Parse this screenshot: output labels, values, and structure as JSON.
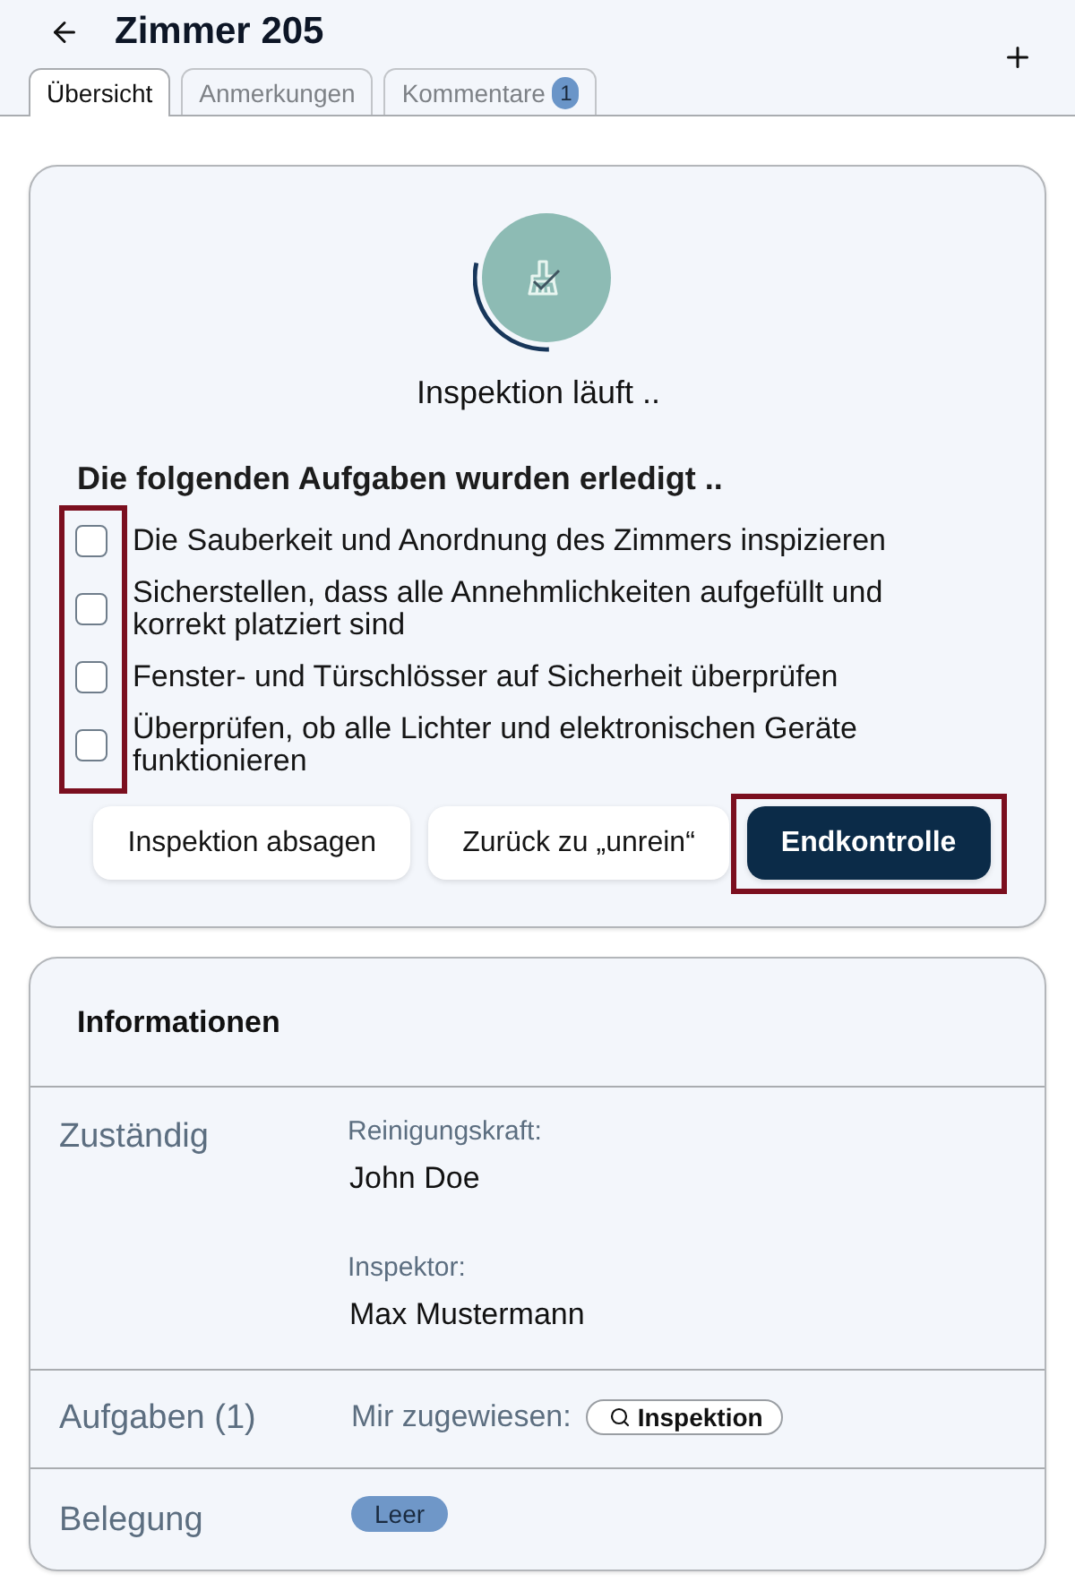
{
  "header": {
    "title": "Zimmer 205"
  },
  "tabs": [
    {
      "label": "Übersicht",
      "selected": true
    },
    {
      "label": "Anmerkungen",
      "selected": false
    },
    {
      "label": "Kommentare",
      "selected": false,
      "badge": "1"
    }
  ],
  "inspection": {
    "status": "Inspektion läuft ..",
    "checklist_title": "Die folgenden Aufgaben wurden erledigt ..",
    "checkboxes_highlighted": true,
    "tasks": [
      {
        "label": "Die Sauberkeit und Anordnung des Zimmers inspizieren",
        "checked": false
      },
      {
        "label": "Sicherstellen, dass alle Annehmlichkeiten aufgefüllt und korrekt platziert sind",
        "checked": false
      },
      {
        "label": "Fenster- und Türschlösser auf Sicherheit überprüfen",
        "checked": false
      },
      {
        "label": "Überprüfen, ob alle Lichter und elektronischen Geräte funktionieren",
        "checked": false
      }
    ],
    "actions": [
      {
        "label": "Inspektion absagen",
        "kind": "secondary",
        "highlighted": false
      },
      {
        "label": "Zurück zu „unrein“",
        "kind": "secondary",
        "highlighted": false
      },
      {
        "label": "Endkontrolle",
        "kind": "primary",
        "highlighted": true
      }
    ]
  },
  "information": {
    "title": "Informationen",
    "rows": [
      {
        "label": "Zuständig",
        "kind": "people",
        "entries": [
          {
            "role": "Reinigungskraft:",
            "name": "John Doe"
          },
          {
            "role": "Inspektor:",
            "name": "Max Mustermann"
          }
        ]
      },
      {
        "label": "Aufgaben (1)",
        "kind": "tasks",
        "prefix": "Mir zugewiesen:",
        "chip": "Inspektion"
      },
      {
        "label": "Belegung",
        "kind": "status",
        "badge": "Leer"
      }
    ]
  }
}
